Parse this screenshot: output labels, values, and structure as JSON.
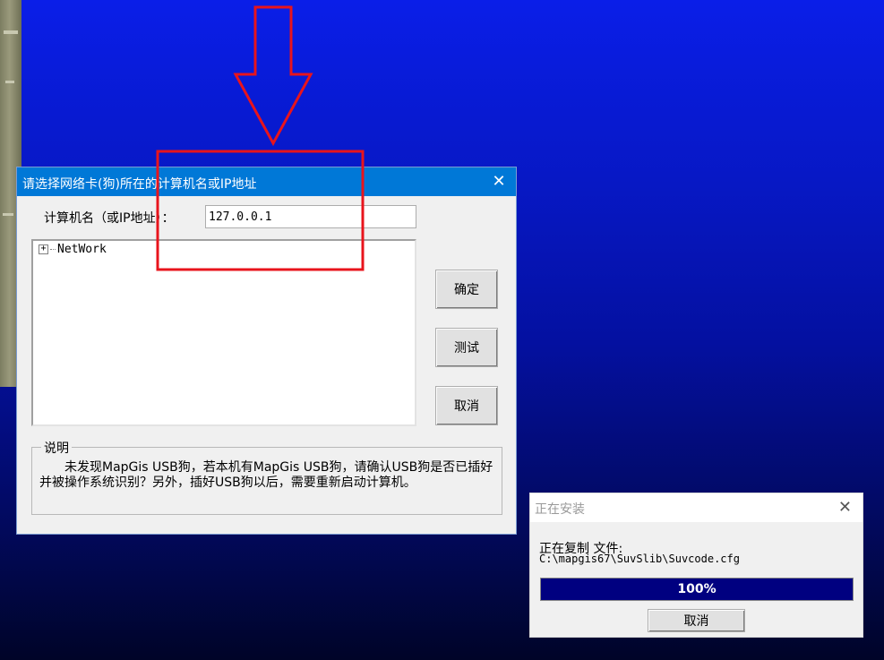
{
  "dialog": {
    "title": "请选择网络卡(狗)所在的计算机名或IP地址",
    "close_glyph": "✕",
    "host_label": "计算机名（或IP地址）：",
    "host_value": "127.0.0.1",
    "tree": {
      "expander": "+",
      "root_label": "NetWork"
    },
    "buttons": {
      "ok": "确定",
      "test": "测试",
      "cancel": "取消"
    },
    "note": {
      "label": "说明",
      "text": "未发现MapGis USB狗，若本机有MapGis USB狗，请确认USB狗是否已插好并被操作系统识别？另外，插好USB狗以后，需要重新启动计算机。"
    }
  },
  "install_dialog": {
    "title": "正在安装",
    "close_glyph": "✕",
    "status": "正在复制 文件:",
    "path": "C:\\mapgis67\\SuvSlib\\Suvcode.cfg",
    "progress": {
      "value": 1.0,
      "label": "100%"
    },
    "cancel": "取消"
  },
  "colors": {
    "titlebar_active": "#0078d7",
    "progress_fill": "#000080",
    "annotation": "#e8141c"
  },
  "icons": {
    "close": "close-icon",
    "expander": "plus-box-icon",
    "arrow": "down-arrow-annotation"
  }
}
